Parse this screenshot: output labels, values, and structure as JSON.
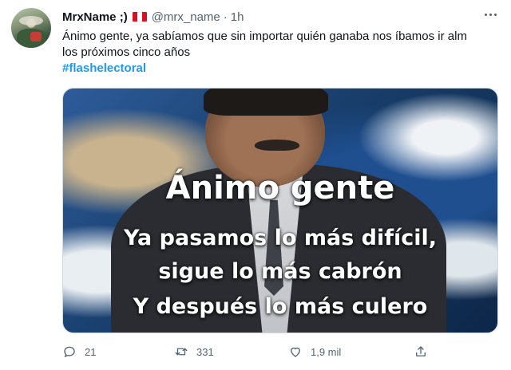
{
  "tweet": {
    "author_name": "MrxName ;)",
    "author_handle": "@mrx_name",
    "separator": "·",
    "time": "1h",
    "flag_icon": "peru-flag-icon",
    "text_line1": "Ánimo gente, ya sabíamos que sin importar quién ganaba nos íbamos ir alm",
    "text_line2": "los próximos cinco años",
    "hashtag": "#flashelectoral"
  },
  "media": {
    "line1": "Ánimo gente",
    "line2": "Ya pasamos lo más difícil,",
    "line3": "sigue lo más cabrón",
    "line4": "Y después lo más culero"
  },
  "actions": {
    "replies": "21",
    "retweets": "331",
    "likes": "1,9 mil"
  },
  "colors": {
    "link": "#1d9bf0",
    "secondary_text": "#536471"
  }
}
